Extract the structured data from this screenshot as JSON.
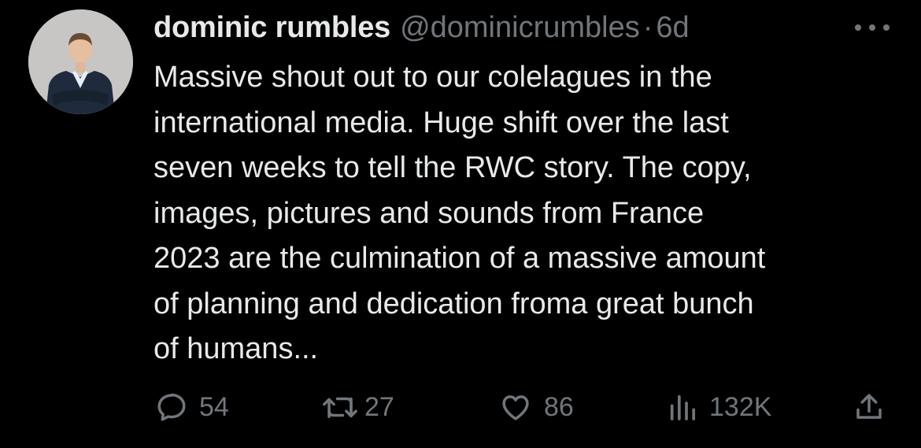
{
  "tweet": {
    "author": {
      "display_name": "dominic rumbles",
      "handle": "@dominicrumbles",
      "separator": "·",
      "timestamp": "6d"
    },
    "text": "Massive shout out to our colelagues in the\ninternational media. Huge shift over the last\nseven weeks to tell the RWC story. The copy,\nimages, pictures and sounds from France\n2023 are the culmination of a massive amount\nof planning and dedication froma  great bunch\nof humans...",
    "actions": {
      "replies": "54",
      "reposts": "27",
      "likes": "86",
      "views": "132K"
    }
  },
  "icons": {
    "avatar": "avatar-photo",
    "more": "more-horizontal-icon",
    "reply": "reply-icon",
    "repost": "repost-icon",
    "like": "heart-icon",
    "views": "views-icon",
    "share": "share-icon"
  },
  "colors": {
    "background": "#000000",
    "primary_text": "#e7e9ea",
    "secondary_text": "#71767b"
  }
}
